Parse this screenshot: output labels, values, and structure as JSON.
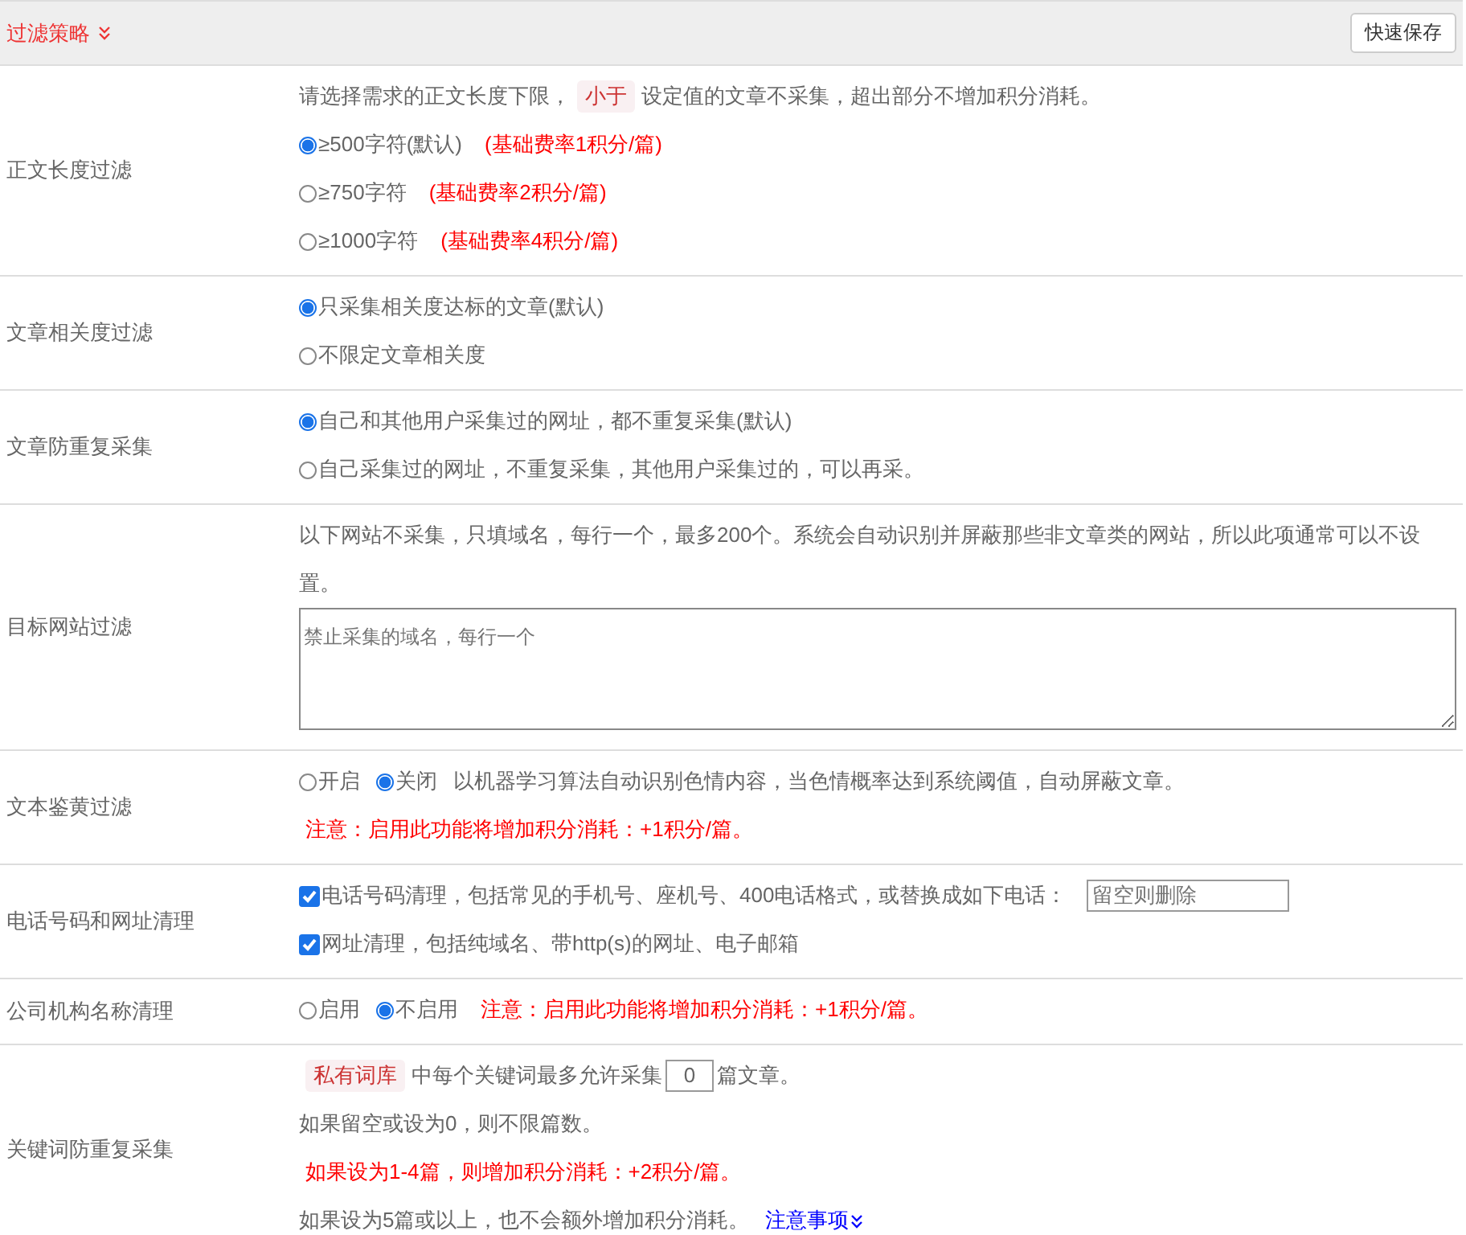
{
  "header": {
    "title": "过滤策略",
    "button": "快速保存"
  },
  "rows": [
    {
      "label": "正文长度过滤",
      "lines": [
        {
          "parts": [
            {
              "kind": "text",
              "text": "请选择需求的正文长度下限，"
            },
            {
              "kind": "tag",
              "text": "小于"
            },
            {
              "kind": "text",
              "text": "设定值的文章不采集，超出部分不增加积分消耗。"
            }
          ]
        },
        {
          "parts": [
            {
              "kind": "radio",
              "label": "≥500字符(默认)",
              "selected": true
            },
            {
              "kind": "note",
              "text": "(基础费率1积分/篇)"
            }
          ]
        },
        {
          "parts": [
            {
              "kind": "radio",
              "label": "≥750字符",
              "selected": false
            },
            {
              "kind": "note",
              "text": "(基础费率2积分/篇)"
            }
          ]
        },
        {
          "parts": [
            {
              "kind": "radio",
              "label": "≥1000字符",
              "selected": false
            },
            {
              "kind": "note",
              "text": "(基础费率4积分/篇)"
            }
          ]
        }
      ]
    },
    {
      "label": "文章相关度过滤",
      "lines": [
        {
          "parts": [
            {
              "kind": "radio",
              "label": "只采集相关度达标的文章(默认)",
              "selected": true
            }
          ]
        },
        {
          "parts": [
            {
              "kind": "radio",
              "label": "不限定文章相关度",
              "selected": false
            }
          ]
        }
      ]
    },
    {
      "label": "文章防重复采集",
      "lines": [
        {
          "parts": [
            {
              "kind": "radio",
              "label": "自己和其他用户采集过的网址，都不重复采集(默认)",
              "selected": true
            }
          ]
        },
        {
          "parts": [
            {
              "kind": "radio",
              "label": "自己采集过的网址，不重复采集，其他用户采集过的，可以再采。",
              "selected": false
            }
          ]
        }
      ]
    },
    {
      "label": "目标网站过滤",
      "lines": [
        {
          "parts": [
            {
              "kind": "text",
              "text": "以下网站不采集，只填域名，每行一个，最多200个。系统会自动识别并屏蔽那些非文章类的网站，所以此项通常可以不设置。"
            }
          ]
        },
        {
          "parts": [
            {
              "kind": "textarea",
              "placeholder": "禁止采集的域名，每行一个"
            }
          ]
        }
      ]
    },
    {
      "label": "文本鉴黄过滤",
      "lines": [
        {
          "parts": [
            {
              "kind": "radio",
              "label": "开启",
              "selected": false
            },
            {
              "kind": "radio",
              "label": "关闭",
              "selected": true
            },
            {
              "kind": "text",
              "text": "以机器学习算法自动识别色情内容，当色情概率达到系统阈值，自动屏蔽文章。"
            }
          ]
        },
        {
          "parts": [
            {
              "kind": "note",
              "text": "注意：启用此功能将增加积分消耗：+1积分/篇。"
            }
          ]
        }
      ]
    },
    {
      "label": "电话号码和网址清理",
      "lines": [
        {
          "parts": [
            {
              "kind": "checkbox",
              "label": "电话号码清理，包括常见的手机号、座机号、400电话格式，或替换成如下电话：",
              "checked": true
            },
            {
              "kind": "input",
              "placeholder": "留空则删除"
            }
          ]
        },
        {
          "parts": [
            {
              "kind": "checkbox",
              "label": "网址清理，包括纯域名、带http(s)的网址、电子邮箱",
              "checked": true
            }
          ]
        }
      ]
    },
    {
      "label": "公司机构名称清理",
      "lines": [
        {
          "parts": [
            {
              "kind": "radio",
              "label": "启用",
              "selected": false
            },
            {
              "kind": "radio",
              "label": "不启用",
              "selected": true
            },
            {
              "kind": "note",
              "text": "注意：启用此功能将增加积分消耗：+1积分/篇。"
            }
          ]
        }
      ]
    },
    {
      "label": "关键词防重复采集",
      "lines": [
        {
          "parts": [
            {
              "kind": "tag",
              "text": "私有词库"
            },
            {
              "kind": "text",
              "text": "中每个关键词最多允许采集"
            },
            {
              "kind": "number",
              "value": "0"
            },
            {
              "kind": "text",
              "text": "篇文章。"
            }
          ]
        },
        {
          "parts": [
            {
              "kind": "text",
              "text": "如果留空或设为0，则不限篇数。"
            }
          ]
        },
        {
          "parts": [
            {
              "kind": "note",
              "text": "如果设为1-4篇，则增加积分消耗：+2积分/篇。"
            }
          ]
        },
        {
          "parts": [
            {
              "kind": "text",
              "text": "如果设为5篇或以上，也不会额外增加积分消耗。"
            },
            {
              "kind": "link",
              "text": "注意事项"
            }
          ]
        }
      ]
    }
  ]
}
